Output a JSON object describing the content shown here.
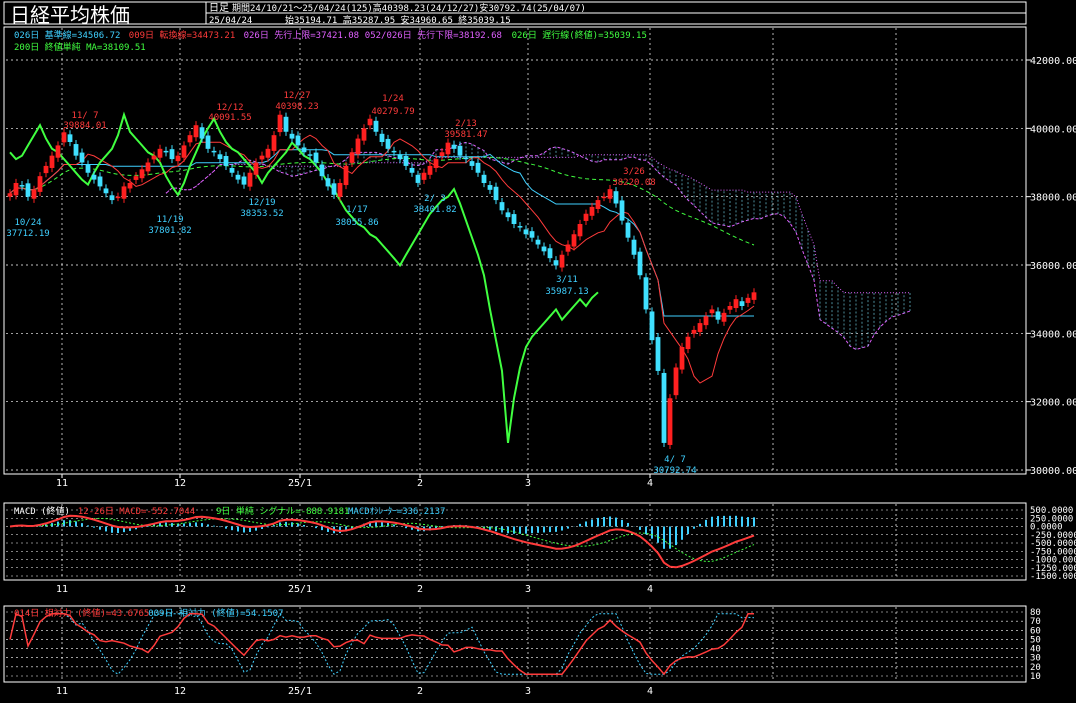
{
  "header": {
    "title": "日経平均株価",
    "period_type": "日足",
    "period_info": "期間24/10/21～25/04/24(125)高40398.23(24/12/27)安30792.74(25/04/07)",
    "date": "25/04/24",
    "ohlc": "始35194.71 高35287.95 安34960.65 終35039.15"
  },
  "legend_top": [
    {
      "text": "026日 基準線=34506.72",
      "color": "#3fd0ff"
    },
    {
      "text": "009日 転換線=34473.21",
      "color": "#ff3b3b"
    },
    {
      "text": "026日 先行上限=37421.08",
      "color": "#e060ff"
    },
    {
      "text": "052/026日 先行下限=38192.68",
      "color": "#e060ff"
    },
    {
      "text": "026日 遅行線(終値)=35039.15",
      "color": "#40ff40"
    }
  ],
  "legend_top2": {
    "text": "200日 終値単純 MA=38109.51",
    "color": "#40ff40"
  },
  "price_axis": [
    "42000.00",
    "40000.00",
    "38000.00",
    "36000.00",
    "34000.00",
    "32000.00",
    "30000.00"
  ],
  "date_axis": [
    "11",
    "12",
    "25/1",
    "2",
    "3",
    "4"
  ],
  "annotations": [
    {
      "date": "11/ 7",
      "value": "39884.01",
      "color": "#ff3b3b"
    },
    {
      "date": "12/12",
      "value": "40091.55",
      "color": "#ff3b3b"
    },
    {
      "date": "12/27",
      "value": "40398.23",
      "color": "#ff3b3b"
    },
    {
      "date": "1/24",
      "value": "40279.79",
      "color": "#ff3b3b"
    },
    {
      "date": "2/13",
      "value": "39581.47",
      "color": "#ff3b3b"
    },
    {
      "date": "3/26",
      "value": "38220.08",
      "color": "#ff3b3b"
    },
    {
      "date": "10/24",
      "value": "37712.19",
      "color": "#3fd0ff"
    },
    {
      "date": "11/19",
      "value": "37801.82",
      "color": "#3fd0ff"
    },
    {
      "date": "12/19",
      "value": "38353.52",
      "color": "#3fd0ff"
    },
    {
      "date": "1/17",
      "value": "38055.86",
      "color": "#3fd0ff"
    },
    {
      "date": "2/ 3",
      "value": "38401.82",
      "color": "#3fd0ff"
    },
    {
      "date": "3/11",
      "value": "35987.13",
      "color": "#3fd0ff"
    },
    {
      "date": "4/ 7",
      "value": "30792.74",
      "color": "#3fd0ff"
    }
  ],
  "macd_legend": [
    {
      "text": "MACD (終値)",
      "color": "#ffffff"
    },
    {
      "text": "12-26日 MACD=-552.7044",
      "color": "#ff3b3b"
    },
    {
      "text": "9日 単純 シグナル=-888.9181",
      "color": "#40ff40"
    },
    {
      "text": "MACDｵｼﾚｰﾀｰ=336.2137",
      "color": "#3fd0ff"
    }
  ],
  "macd_axis": [
    "500.0000",
    "250.0000",
    "0.0000",
    "-250.0000",
    "-500.0000",
    "-750.0000",
    "-1000.0000",
    "-1250.0000",
    "-1500.0000"
  ],
  "rsi_legend": [
    {
      "text": "014日 相対力 (終値)=43.6765",
      "color": "#ff3b3b"
    },
    {
      "text": "009日 相対力 (終値)=54.1507",
      "color": "#3fd0ff"
    }
  ],
  "rsi_axis": [
    "80",
    "70",
    "60",
    "50",
    "40",
    "30",
    "20",
    "10"
  ],
  "colors": {
    "up": "#ff2020",
    "down": "#40e0ff",
    "kijun": "#3fd0ff",
    "tenkan": "#ff3b3b",
    "spanA": "#e060ff",
    "chikou": "#40ff40",
    "ma200": "#40ff40",
    "grid": "#ffffff"
  },
  "chart_data": [
    {
      "type": "candlestick",
      "title": "日経平均株価",
      "ylim": [
        30000,
        42000
      ],
      "x_ticks": [
        "11",
        "12",
        "25/1",
        "2",
        "3",
        "4"
      ],
      "series": [
        {
          "name": "026日 基準線",
          "last": 34506.72
        },
        {
          "name": "009日 転換線",
          "last": 34473.21
        },
        {
          "name": "026日 先行上限",
          "last": 37421.08
        },
        {
          "name": "052/026日 先行下限",
          "last": 38192.68
        },
        {
          "name": "026日 遅行線(終値)",
          "last": 35039.15
        },
        {
          "name": "200日 終値単純 MA",
          "last": 38109.51
        }
      ],
      "closes": [
        38100,
        38400,
        38300,
        38000,
        38200,
        38600,
        38900,
        39200,
        39500,
        39884,
        39600,
        39200,
        39000,
        38700,
        38500,
        38300,
        38100,
        37900,
        38000,
        38300,
        38400,
        38600,
        38800,
        39000,
        39200,
        39400,
        39300,
        39100,
        39200,
        39500,
        39800,
        40091,
        39700,
        39400,
        39300,
        39100,
        38900,
        38700,
        38500,
        38353,
        38700,
        39000,
        39200,
        39400,
        39800,
        40398,
        39900,
        39700,
        39500,
        39300,
        39200,
        39000,
        38600,
        38300,
        38056,
        38400,
        38900,
        39300,
        39700,
        40000,
        40280,
        39900,
        39600,
        39400,
        39300,
        39100,
        38900,
        38700,
        38402,
        38700,
        38900,
        39100,
        39300,
        39581,
        39400,
        39200,
        39100,
        38900,
        38700,
        38400,
        38200,
        37900,
        37600,
        37400,
        37200,
        37100,
        36900,
        36800,
        36600,
        36400,
        36200,
        35987,
        36300,
        36600,
        36900,
        37200,
        37500,
        37700,
        37900,
        38000,
        38220,
        37800,
        37300,
        36800,
        36300,
        35700,
        34700,
        33800,
        32900,
        30793,
        32100,
        33000,
        33600,
        33900,
        34100,
        34300,
        34500,
        34700,
        34400,
        34600,
        34800,
        35000,
        34800,
        35039,
        35200
      ]
    },
    {
      "type": "line",
      "title": "MACD (終値)",
      "ylim": [
        -1500,
        500
      ],
      "series": [
        {
          "name": "12-26日 MACD",
          "last": -552.7044
        },
        {
          "name": "9日 単純 シグナル",
          "last": -888.9181
        },
        {
          "name": "MACDｵｼﾚｰﾀｰ",
          "last": 336.2137
        }
      ]
    },
    {
      "type": "line",
      "title": "相対力",
      "ylim": [
        10,
        80
      ],
      "series": [
        {
          "name": "014日 相対力 (終値)",
          "last": 43.6765
        },
        {
          "name": "009日 相対力 (終値)",
          "last": 54.1507
        }
      ]
    }
  ]
}
